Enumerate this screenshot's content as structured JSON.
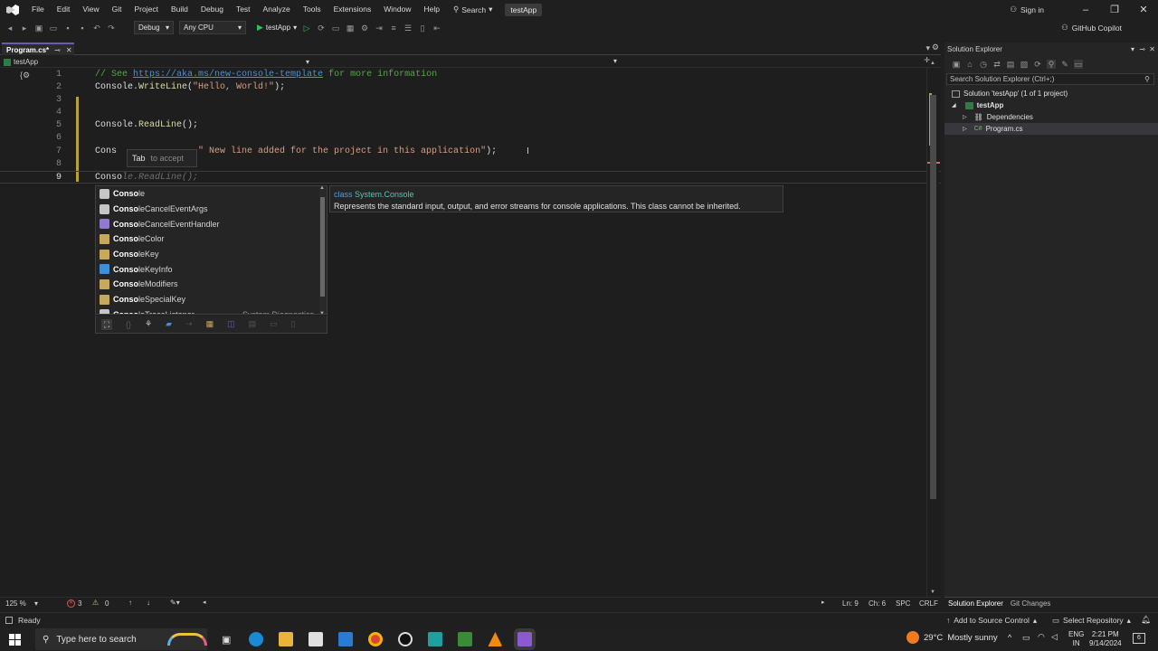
{
  "menubar": {
    "items": [
      "File",
      "Edit",
      "View",
      "Git",
      "Project",
      "Build",
      "Debug",
      "Test",
      "Analyze",
      "Tools",
      "Extensions",
      "Window",
      "Help"
    ],
    "search_label": "Search",
    "app_title": "testApp",
    "signin": "Sign in"
  },
  "toolbar": {
    "config": "Debug",
    "platform": "Any CPU",
    "run_target": "testApp",
    "copilot": "GitHub Copilot"
  },
  "tabs": [
    {
      "label": "Program.cs*"
    }
  ],
  "navbar": {
    "project": "testApp"
  },
  "editor": {
    "lines": [
      {
        "num": "1"
      },
      {
        "num": "2"
      },
      {
        "num": "3"
      },
      {
        "num": "4"
      },
      {
        "num": "5"
      },
      {
        "num": "6"
      },
      {
        "num": "7"
      },
      {
        "num": "8"
      },
      {
        "num": "9"
      }
    ],
    "line1_comment_pre": "// See ",
    "line1_url": "https://aka.ms/new-console-template",
    "line1_comment_post": " for more information",
    "line2_type": "Console.",
    "line2_method": "WriteLine",
    "line2_string": "\"Hello, World!\"",
    "line2_end": ");",
    "line5_type": "Console.",
    "line5_method": "ReadLine",
    "line5_end": "();",
    "line7_prefix": "Cons",
    "line7_string": "\" New line added for the project in this application\"",
    "line7_end": ");",
    "line9_typed": "Conso",
    "line9_ghost": "le.ReadLine();",
    "tab_hint_key": "Tab",
    "tab_hint_text": "to accept"
  },
  "completion": {
    "items": [
      {
        "match": "Conso",
        "rest": "le",
        "kind": "class-icon"
      },
      {
        "match": "Conso",
        "rest": "leCancelEventArgs",
        "kind": "class-icon"
      },
      {
        "match": "Conso",
        "rest": "leCancelEventHandler",
        "kind": "delegate-icon"
      },
      {
        "match": "Conso",
        "rest": "leColor",
        "kind": "enum-icon"
      },
      {
        "match": "Conso",
        "rest": "leKey",
        "kind": "enum-icon"
      },
      {
        "match": "Conso",
        "rest": "leKeyInfo",
        "kind": "struct-icon"
      },
      {
        "match": "Conso",
        "rest": "leModifiers",
        "kind": "enum-icon"
      },
      {
        "match": "Conso",
        "rest": "leSpecialKey",
        "kind": "enum-icon"
      },
      {
        "match": "Conso",
        "rest": "leTraceListener",
        "kind": "class-icon",
        "suffix": "System.Diagnostics"
      }
    ]
  },
  "quickinfo": {
    "kind": "class",
    "name": "System.Console",
    "description": "Represents the standard input, output, and error streams for console applications. This class cannot be inherited."
  },
  "editor_status": {
    "zoom": "125 %",
    "errors": "3",
    "warnings": "0",
    "line": "Ln: 9",
    "col": "Ch: 6",
    "spc": "SPC",
    "crlf": "CRLF"
  },
  "solution_explorer": {
    "title": "Solution Explorer",
    "search_placeholder": "Search Solution Explorer (Ctrl+;)",
    "solution": "Solution 'testApp' (1 of 1 project)",
    "project": "testApp",
    "dependencies": "Dependencies",
    "file_prefix": "C#",
    "file": "Program.cs",
    "footer_tabs": [
      "Solution Explorer",
      "Git Changes"
    ]
  },
  "statusbar": {
    "ready": "Ready",
    "source_control": "Add to Source Control",
    "repository": "Select Repository"
  },
  "taskbar": {
    "search_placeholder": "Type here to search",
    "weather_temp": "29°C",
    "weather_text": "Mostly sunny",
    "lang1": "ENG",
    "lang2": "IN",
    "time": "2:21 PM",
    "date": "9/14/2024",
    "notifications": "6"
  },
  "colors": {
    "accent": "#6b5ab0",
    "comment": "#57a64a",
    "string": "#d69d85",
    "method": "#dcdcaa",
    "link": "#4b8fd8"
  }
}
